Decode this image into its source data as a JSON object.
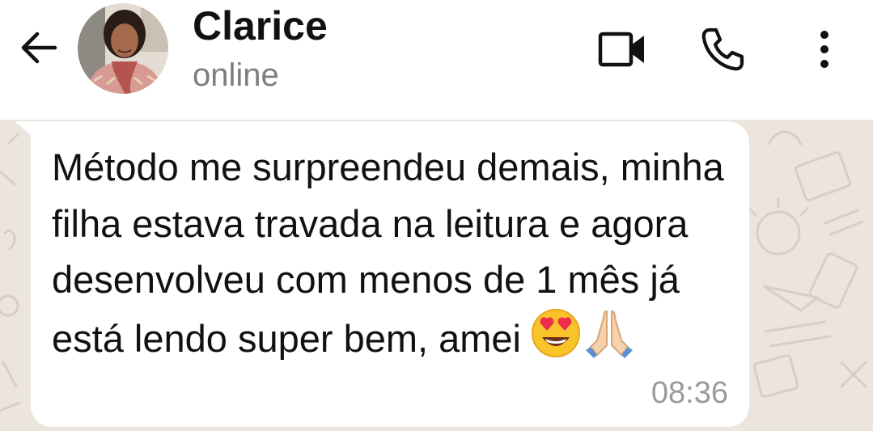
{
  "header": {
    "contact_name": "Clarice",
    "status": "online",
    "back_icon": "arrow-left-icon",
    "video_icon": "video-camera-icon",
    "call_icon": "phone-icon",
    "menu_icon": "more-vertical-icon"
  },
  "message": {
    "text": "Método me surpreendeu demais, minha filha estava travada na leitura e agora desenvolveu com menos de 1 mês já está lendo super bem, amei",
    "emojis": [
      "heart-eyes-face-emoji",
      "folded-hands-emoji"
    ],
    "time": "08:36"
  },
  "colors": {
    "chat_background": "#ece5dd",
    "bubble": "#ffffff",
    "status_text": "#7d7d7d",
    "timestamp": "#9a9a9a"
  }
}
